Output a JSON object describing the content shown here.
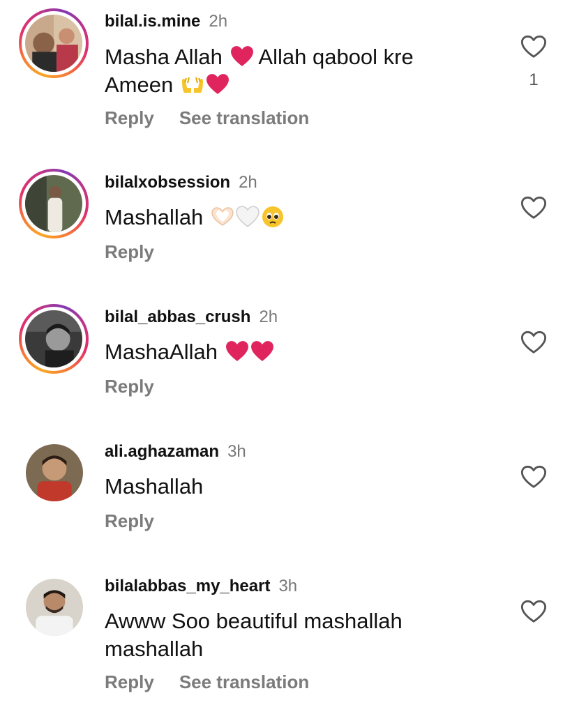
{
  "comments": [
    {
      "username": "bilal.is.mine",
      "time": "2h",
      "text": "Masha Allah",
      "text_2": "Allah qabool kre",
      "text_line2": "Ameen",
      "like_count": "1",
      "reply_label": "Reply",
      "translation_label": "See translation"
    },
    {
      "username": "bilalxobsession",
      "time": "2h",
      "text": "Mashallah",
      "reply_label": "Reply"
    },
    {
      "username": "bilal_abbas_crush",
      "time": "2h",
      "text": "MashaAllah",
      "reply_label": "Reply"
    },
    {
      "username": "ali.aghazaman",
      "time": "3h",
      "text": "Mashallah",
      "reply_label": "Reply"
    },
    {
      "username": "bilalabbas_my_heart",
      "time": "3h",
      "text": "Awww Soo beautiful mashallah",
      "text_line2": "mashallah",
      "reply_label": "Reply",
      "translation_label": "See translation"
    }
  ],
  "icons": {
    "like": "heart-outline-icon",
    "emoji_red_heart": "red-heart-emoji",
    "emoji_palms": "palms-up-emoji",
    "emoji_heart_hands": "heart-hands-emoji",
    "emoji_white_heart": "white-heart-emoji",
    "emoji_pleading": "pleading-face-emoji"
  },
  "colors": {
    "story_ring_start": "#f9a825",
    "story_ring_end": "#c13584",
    "secondary_text": "#7b7b7b",
    "heart_red": "#e0245e"
  }
}
